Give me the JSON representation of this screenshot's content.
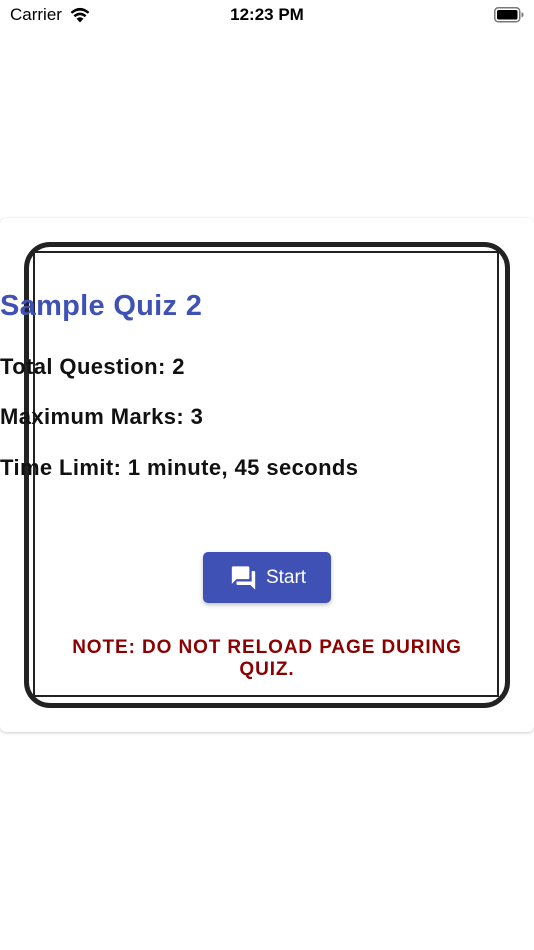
{
  "status_bar": {
    "carrier": "Carrier",
    "time": "12:23 PM",
    "wifi_icon": "wifi-icon",
    "battery_icon": "battery-icon"
  },
  "quiz": {
    "title": "Sample Quiz 2",
    "total_questions": "Total Question: 2",
    "maximum_marks": "Maximum Marks: 3",
    "time_limit": "Time Limit: 1 minute, 45 seconds",
    "start_label": "Start",
    "start_icon": "chat-bubbles-icon",
    "note": "NOTE: DO NOT RELOAD PAGE DURING QUIZ."
  },
  "colors": {
    "accent": "#3f51b5",
    "warning": "#8b0000"
  }
}
